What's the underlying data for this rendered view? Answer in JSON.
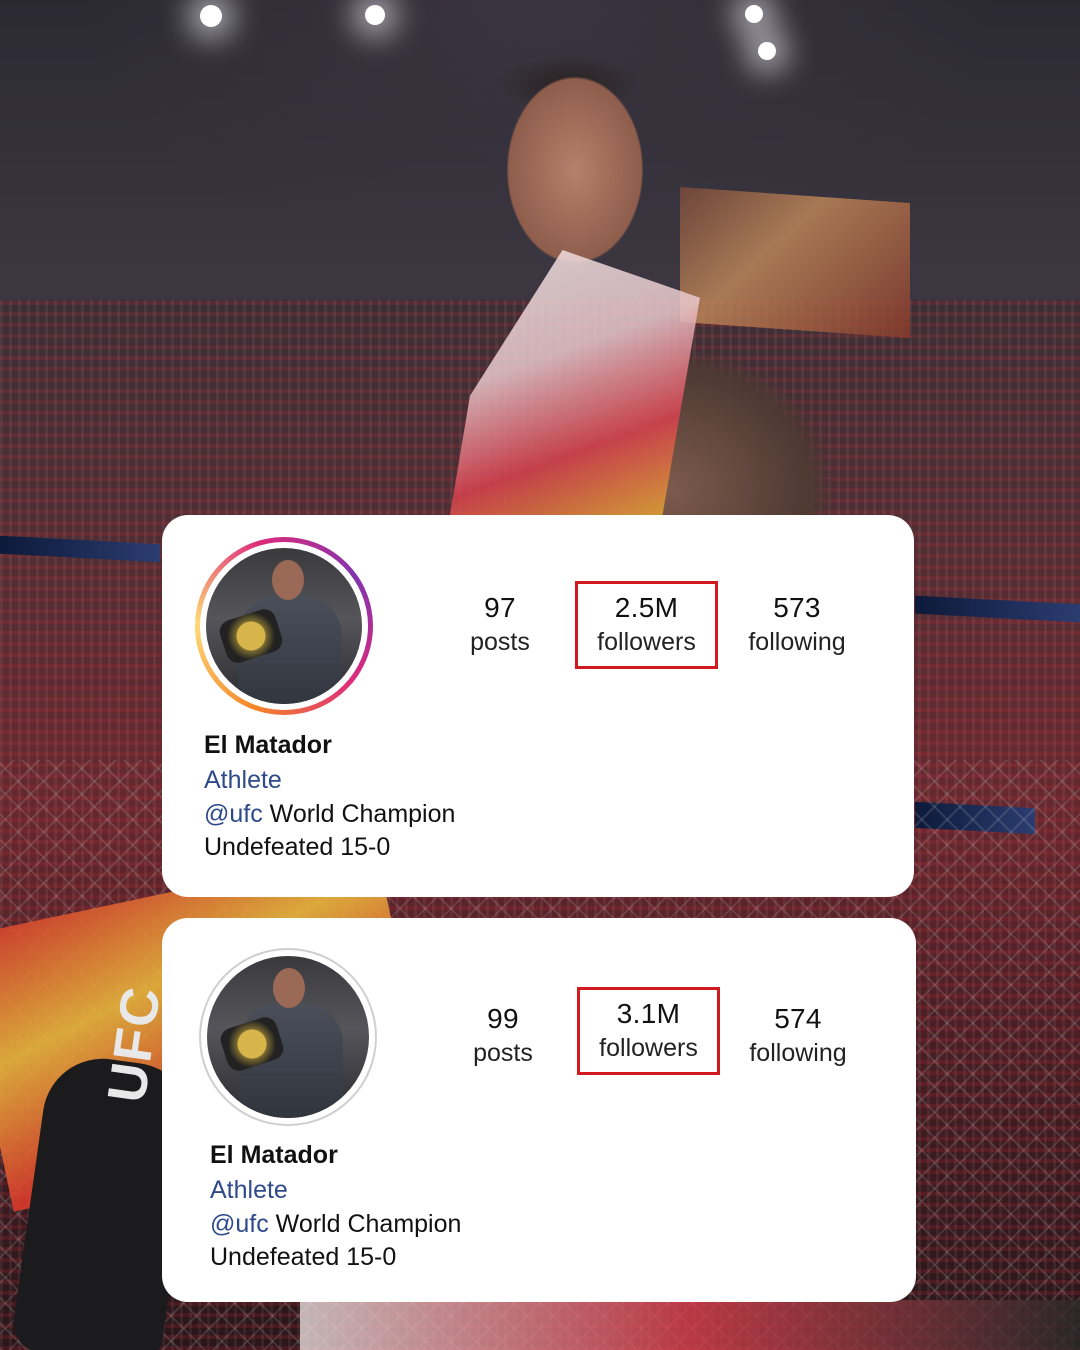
{
  "background": {
    "glove_text": "UFC"
  },
  "profiles": [
    {
      "avatar_ring": "story-gradient",
      "stats": {
        "posts_count": "97",
        "posts_label": "posts",
        "followers_count": "2.5M",
        "followers_label": "followers",
        "following_count": "573",
        "following_label": "following"
      },
      "name": "El Matador",
      "category": "Athlete",
      "bio_mention": "@ufc",
      "bio_line1_rest": " World Champion",
      "bio_line2": "Undefeated 15-0",
      "highlight_color": "#d01a1f"
    },
    {
      "avatar_ring": "none",
      "stats": {
        "posts_count": "99",
        "posts_label": "posts",
        "followers_count": "3.1M",
        "followers_label": "followers",
        "following_count": "574",
        "following_label": "following"
      },
      "name": "El Matador",
      "category": "Athlete",
      "bio_mention": "@ufc",
      "bio_line1_rest": " World Champion",
      "bio_line2": "Undefeated 15-0",
      "highlight_color": "#d01a1f"
    }
  ],
  "colors": {
    "link_blue": "#2e4a8a",
    "highlight_red": "#d01a1f",
    "card_bg": "#ffffff"
  }
}
